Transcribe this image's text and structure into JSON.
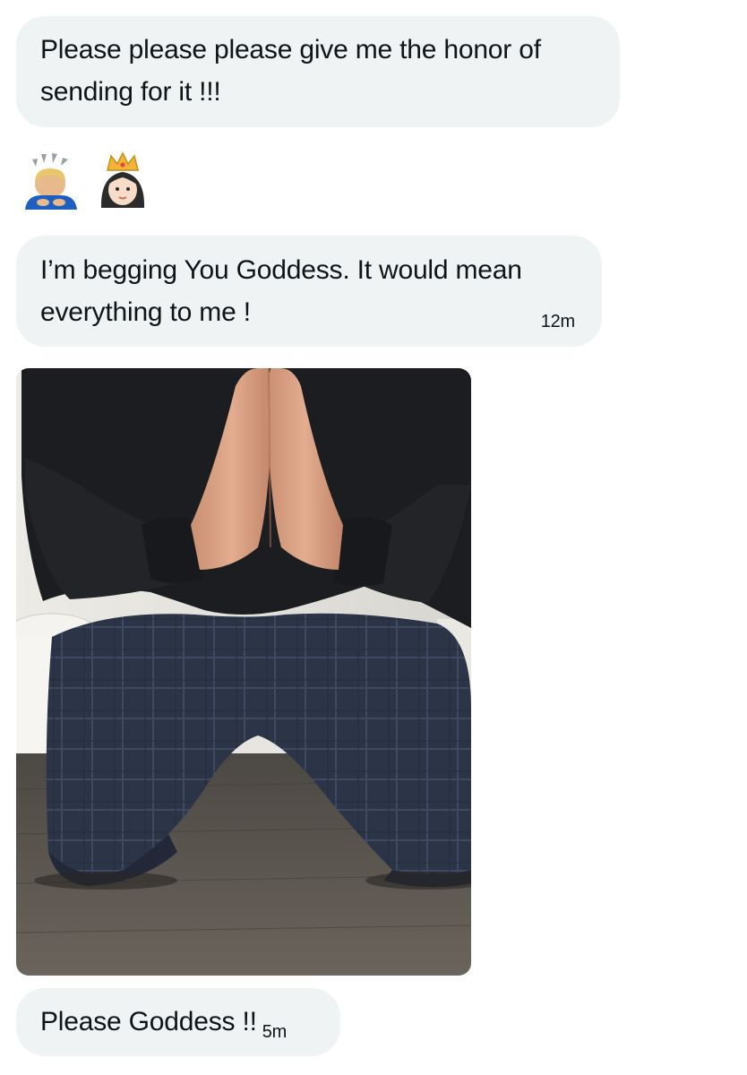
{
  "messages": [
    {
      "text": "Please please please give me the honor of sending for it !!!",
      "time": ""
    },
    {
      "emojis": [
        "person-bowing-emoji",
        "princess-emoji"
      ]
    },
    {
      "text": "I’m begging You Goddess. It would mean everything to me !",
      "time": "12m"
    },
    {
      "image": "photo-kneeling-hands-pressed"
    },
    {
      "text": "Please Goddess !!",
      "time": "5m"
    }
  ],
  "colors": {
    "bubble_bg": "#eff3f4",
    "text": "#0f1419"
  }
}
